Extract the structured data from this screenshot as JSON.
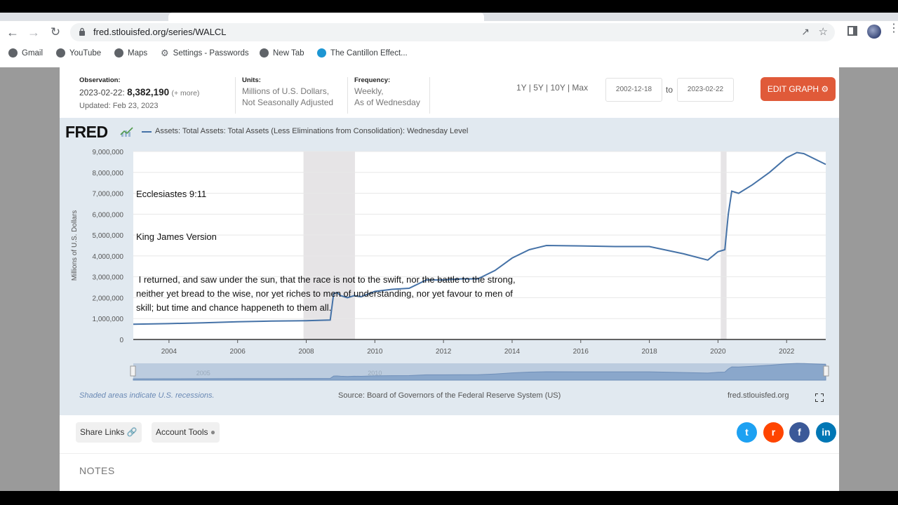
{
  "browser": {
    "url": "fred.stlouisfed.org/series/WALCL",
    "bookmarks": [
      "Gmail",
      "YouTube",
      "Maps",
      "Settings - Passwords",
      "New Tab",
      "The Cantillon Effect..."
    ]
  },
  "observation": {
    "label": "Observation:",
    "date": "2023-02-22:",
    "value": "8,382,190",
    "more": "(+ more)",
    "updated": "Updated: Feb 23, 2023"
  },
  "units": {
    "label": "Units:",
    "line1": "Millions of U.S. Dollars,",
    "line2": "Not Seasonally Adjusted"
  },
  "frequency": {
    "label": "Frequency:",
    "line1": "Weekly,",
    "line2": "As of Wednesday"
  },
  "controls": {
    "ranges": "1Y | 5Y | 10Y | Max",
    "start_date": "2002-12-18",
    "to_label": "to",
    "end_date": "2023-02-22",
    "edit_graph": "EDIT GRAPH"
  },
  "graph": {
    "logo": "FRED",
    "legend": "Assets: Total Assets: Total Assets (Less Eliminations from Consolidation): Wednesday Level",
    "footer_note": "Shaded areas indicate U.S. recessions.",
    "source": "Source: Board of Governors of the Federal Reserve System (US)",
    "site": "fred.stlouisfed.org",
    "navigator_labels": [
      "2005",
      "2010"
    ]
  },
  "overlay": {
    "line1": "Ecclesiastes 9:11",
    "line2": "King James Version",
    "body": " I returned, and saw under the sun, that the race is not to the swift, nor the battle to the strong, neither yet bread to the wise, nor yet riches to men of understanding, nor yet favour to men of skill; but time and chance happeneth to them all."
  },
  "tools": {
    "share_links": "Share Links",
    "account_tools": "Account Tools"
  },
  "social": {
    "twitter_color": "#1da1f2",
    "reddit_color": "#ff4500",
    "facebook_color": "#3b5998",
    "linkedin_color": "#0077b5"
  },
  "notes_heading": "NOTES",
  "chart_data": {
    "type": "line",
    "ylabel": "Millions of U.S. Dollars",
    "ylim": [
      0,
      9000000
    ],
    "yticks": [
      0,
      1000000,
      2000000,
      3000000,
      4000000,
      5000000,
      6000000,
      7000000,
      8000000,
      9000000
    ],
    "ytick_labels": [
      "0",
      "1,000,000",
      "2,000,000",
      "3,000,000",
      "4,000,000",
      "5,000,000",
      "6,000,000",
      "7,000,000",
      "8,000,000",
      "9,000,000"
    ],
    "xlim": [
      2002.96,
      2023.14
    ],
    "xticks": [
      2004,
      2006,
      2008,
      2010,
      2012,
      2014,
      2016,
      2018,
      2020,
      2022
    ],
    "grid": true,
    "recessions": [
      [
        2007.92,
        2009.42
      ],
      [
        2020.08,
        2020.25
      ]
    ],
    "series": [
      {
        "name": "Assets: Total Assets: Total Assets (Less Eliminations from Consolidation): Wednesday Level",
        "color": "#4572a7",
        "x": [
          2002.96,
          2004.0,
          2005.0,
          2006.0,
          2007.0,
          2008.0,
          2008.7,
          2008.8,
          2008.9,
          2009.0,
          2009.2,
          2009.4,
          2009.6,
          2010.0,
          2010.5,
          2011.0,
          2011.5,
          2012.0,
          2012.5,
          2013.0,
          2013.5,
          2014.0,
          2014.5,
          2015.0,
          2016.0,
          2017.0,
          2018.0,
          2019.0,
          2019.7,
          2020.0,
          2020.2,
          2020.3,
          2020.4,
          2020.6,
          2021.0,
          2021.5,
          2022.0,
          2022.3,
          2022.5,
          2023.14
        ],
        "values": [
          730000,
          760000,
          800000,
          850000,
          880000,
          900000,
          930000,
          2200000,
          2250000,
          2100000,
          2000000,
          2100000,
          2050000,
          2300000,
          2400000,
          2450000,
          2850000,
          2850000,
          2900000,
          2900000,
          3300000,
          3900000,
          4300000,
          4500000,
          4480000,
          4450000,
          4450000,
          4100000,
          3800000,
          4200000,
          4300000,
          6000000,
          7100000,
          7000000,
          7400000,
          8000000,
          8700000,
          8950000,
          8900000,
          8382190
        ]
      }
    ]
  }
}
